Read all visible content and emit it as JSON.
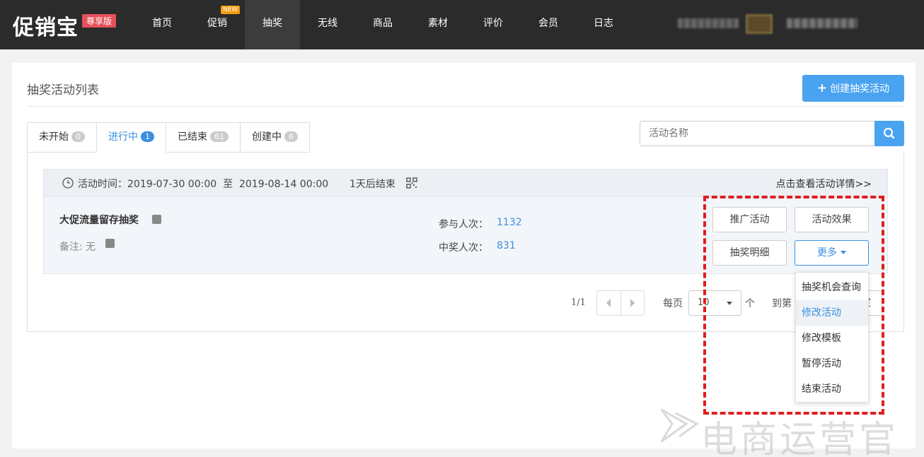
{
  "header": {
    "logo": "促销宝",
    "edition": "尊享版",
    "nav": [
      {
        "label": "首页"
      },
      {
        "label": "促销",
        "badge": "NEW"
      },
      {
        "label": "抽奖",
        "active": true
      },
      {
        "label": "无线"
      },
      {
        "label": "商品"
      },
      {
        "label": "素材"
      },
      {
        "label": "评价"
      },
      {
        "label": "会员"
      },
      {
        "label": "日志"
      }
    ]
  },
  "page": {
    "title": "抽奖活动列表",
    "create_button": "创建抽奖活动"
  },
  "tabs": [
    {
      "label": "未开始",
      "count": "0"
    },
    {
      "label": "进行中",
      "count": "1",
      "active": true
    },
    {
      "label": "已结束",
      "count": "61"
    },
    {
      "label": "创建中",
      "count": "6"
    }
  ],
  "search": {
    "placeholder": "活动名称"
  },
  "activity": {
    "time_label": "活动时间：",
    "start": "2019-07-30 00:00",
    "to": "至",
    "end": "2019-08-14 00:00",
    "countdown": "1天后结束",
    "detail_link": "点击查看活动详情>>",
    "name": "大促流量留存抽奖",
    "remark_label": "备注:",
    "remark_value": "无",
    "participants_label": "参与人次：",
    "participants": "1132",
    "winners_label": "中奖人次：",
    "winners": "831",
    "buttons": {
      "promote": "推广活动",
      "effect": "活动效果",
      "details": "抽奖明细",
      "more": "更多"
    }
  },
  "pagination": {
    "info": "1/1",
    "per_page_label": "每页",
    "per_page_value": "10",
    "per_page_unit": "个",
    "goto_label": "到第",
    "confirm": "定"
  },
  "dropdown": {
    "items": [
      "抽奖机会查询",
      "修改活动",
      "修改模板",
      "暂停活动",
      "结束活动"
    ]
  },
  "watermark": {
    "text": "电商运营官"
  },
  "colors": {
    "accent": "#4aa3f0",
    "nav_bg": "#2b2b2b",
    "highlight": "#e01e1e"
  }
}
